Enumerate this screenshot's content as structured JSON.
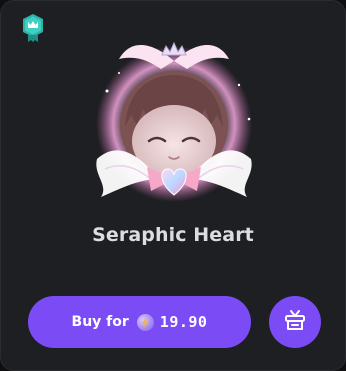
{
  "item": {
    "name": "Seraphic Heart",
    "badge_icon": "crown-badge-icon",
    "art_icon": "angel-wings-avatar-decoration"
  },
  "actions": {
    "buy_label": "Buy for",
    "currency_icon": "lightning-orb-icon",
    "price": "19.90",
    "gift_icon": "gift-icon"
  },
  "colors": {
    "card_background": "#1e1f22",
    "accent": "#7b4cf5",
    "title_text": "#dcdde1",
    "badge": "#2ab3a6"
  }
}
